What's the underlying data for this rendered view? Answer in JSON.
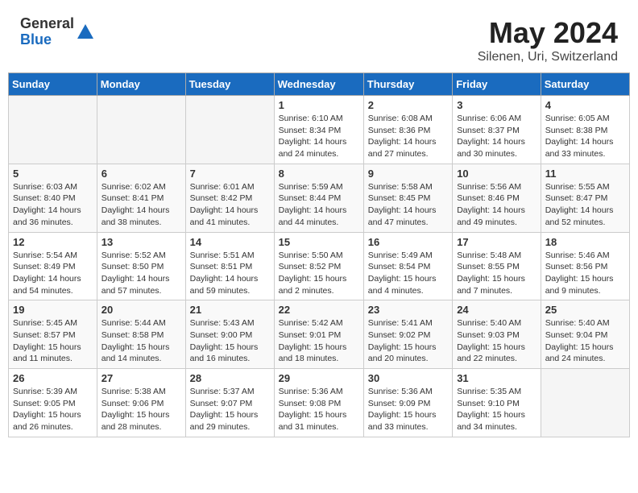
{
  "header": {
    "logo_general": "General",
    "logo_blue": "Blue",
    "month_title": "May 2024",
    "location": "Silenen, Uri, Switzerland"
  },
  "days_of_week": [
    "Sunday",
    "Monday",
    "Tuesday",
    "Wednesday",
    "Thursday",
    "Friday",
    "Saturday"
  ],
  "weeks": [
    [
      {
        "num": "",
        "info": ""
      },
      {
        "num": "",
        "info": ""
      },
      {
        "num": "",
        "info": ""
      },
      {
        "num": "1",
        "info": "Sunrise: 6:10 AM\nSunset: 8:34 PM\nDaylight: 14 hours and 24 minutes."
      },
      {
        "num": "2",
        "info": "Sunrise: 6:08 AM\nSunset: 8:36 PM\nDaylight: 14 hours and 27 minutes."
      },
      {
        "num": "3",
        "info": "Sunrise: 6:06 AM\nSunset: 8:37 PM\nDaylight: 14 hours and 30 minutes."
      },
      {
        "num": "4",
        "info": "Sunrise: 6:05 AM\nSunset: 8:38 PM\nDaylight: 14 hours and 33 minutes."
      }
    ],
    [
      {
        "num": "5",
        "info": "Sunrise: 6:03 AM\nSunset: 8:40 PM\nDaylight: 14 hours and 36 minutes."
      },
      {
        "num": "6",
        "info": "Sunrise: 6:02 AM\nSunset: 8:41 PM\nDaylight: 14 hours and 38 minutes."
      },
      {
        "num": "7",
        "info": "Sunrise: 6:01 AM\nSunset: 8:42 PM\nDaylight: 14 hours and 41 minutes."
      },
      {
        "num": "8",
        "info": "Sunrise: 5:59 AM\nSunset: 8:44 PM\nDaylight: 14 hours and 44 minutes."
      },
      {
        "num": "9",
        "info": "Sunrise: 5:58 AM\nSunset: 8:45 PM\nDaylight: 14 hours and 47 minutes."
      },
      {
        "num": "10",
        "info": "Sunrise: 5:56 AM\nSunset: 8:46 PM\nDaylight: 14 hours and 49 minutes."
      },
      {
        "num": "11",
        "info": "Sunrise: 5:55 AM\nSunset: 8:47 PM\nDaylight: 14 hours and 52 minutes."
      }
    ],
    [
      {
        "num": "12",
        "info": "Sunrise: 5:54 AM\nSunset: 8:49 PM\nDaylight: 14 hours and 54 minutes."
      },
      {
        "num": "13",
        "info": "Sunrise: 5:52 AM\nSunset: 8:50 PM\nDaylight: 14 hours and 57 minutes."
      },
      {
        "num": "14",
        "info": "Sunrise: 5:51 AM\nSunset: 8:51 PM\nDaylight: 14 hours and 59 minutes."
      },
      {
        "num": "15",
        "info": "Sunrise: 5:50 AM\nSunset: 8:52 PM\nDaylight: 15 hours and 2 minutes."
      },
      {
        "num": "16",
        "info": "Sunrise: 5:49 AM\nSunset: 8:54 PM\nDaylight: 15 hours and 4 minutes."
      },
      {
        "num": "17",
        "info": "Sunrise: 5:48 AM\nSunset: 8:55 PM\nDaylight: 15 hours and 7 minutes."
      },
      {
        "num": "18",
        "info": "Sunrise: 5:46 AM\nSunset: 8:56 PM\nDaylight: 15 hours and 9 minutes."
      }
    ],
    [
      {
        "num": "19",
        "info": "Sunrise: 5:45 AM\nSunset: 8:57 PM\nDaylight: 15 hours and 11 minutes."
      },
      {
        "num": "20",
        "info": "Sunrise: 5:44 AM\nSunset: 8:58 PM\nDaylight: 15 hours and 14 minutes."
      },
      {
        "num": "21",
        "info": "Sunrise: 5:43 AM\nSunset: 9:00 PM\nDaylight: 15 hours and 16 minutes."
      },
      {
        "num": "22",
        "info": "Sunrise: 5:42 AM\nSunset: 9:01 PM\nDaylight: 15 hours and 18 minutes."
      },
      {
        "num": "23",
        "info": "Sunrise: 5:41 AM\nSunset: 9:02 PM\nDaylight: 15 hours and 20 minutes."
      },
      {
        "num": "24",
        "info": "Sunrise: 5:40 AM\nSunset: 9:03 PM\nDaylight: 15 hours and 22 minutes."
      },
      {
        "num": "25",
        "info": "Sunrise: 5:40 AM\nSunset: 9:04 PM\nDaylight: 15 hours and 24 minutes."
      }
    ],
    [
      {
        "num": "26",
        "info": "Sunrise: 5:39 AM\nSunset: 9:05 PM\nDaylight: 15 hours and 26 minutes."
      },
      {
        "num": "27",
        "info": "Sunrise: 5:38 AM\nSunset: 9:06 PM\nDaylight: 15 hours and 28 minutes."
      },
      {
        "num": "28",
        "info": "Sunrise: 5:37 AM\nSunset: 9:07 PM\nDaylight: 15 hours and 29 minutes."
      },
      {
        "num": "29",
        "info": "Sunrise: 5:36 AM\nSunset: 9:08 PM\nDaylight: 15 hours and 31 minutes."
      },
      {
        "num": "30",
        "info": "Sunrise: 5:36 AM\nSunset: 9:09 PM\nDaylight: 15 hours and 33 minutes."
      },
      {
        "num": "31",
        "info": "Sunrise: 5:35 AM\nSunset: 9:10 PM\nDaylight: 15 hours and 34 minutes."
      },
      {
        "num": "",
        "info": ""
      }
    ]
  ]
}
